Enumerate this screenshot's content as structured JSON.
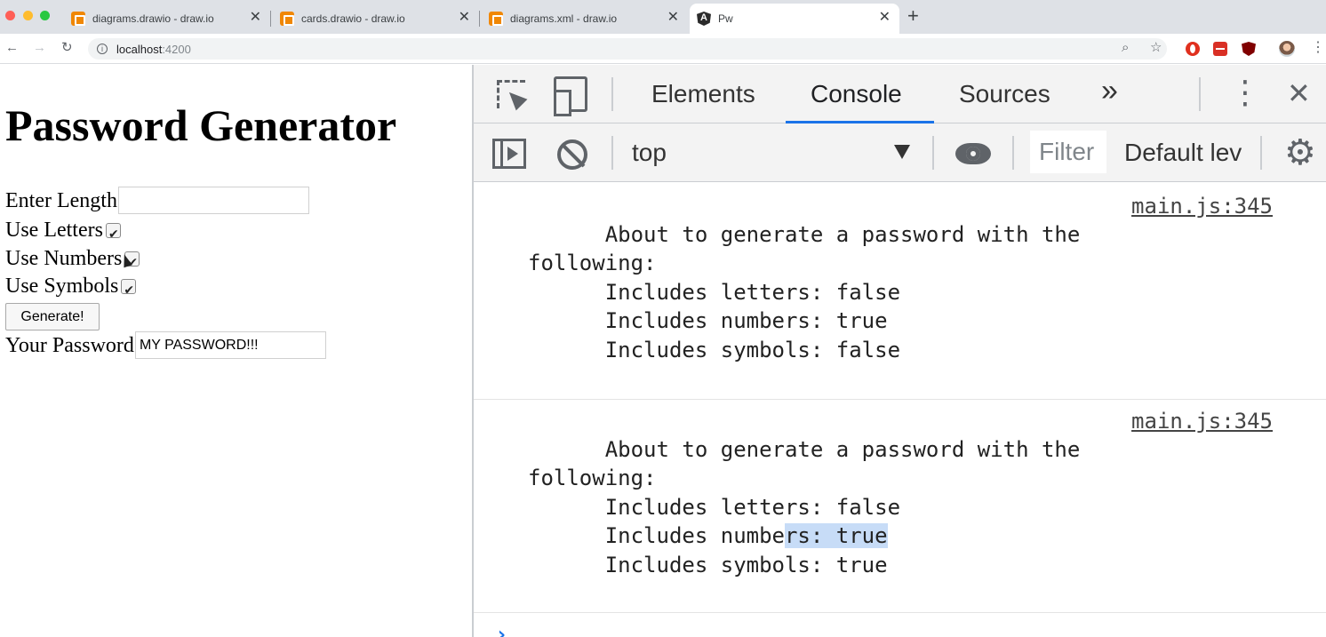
{
  "browser": {
    "tabs": [
      {
        "title": "diagrams.drawio - draw.io",
        "icon": "drawio-icon",
        "active": false
      },
      {
        "title": "cards.drawio - draw.io",
        "icon": "drawio-icon",
        "active": false
      },
      {
        "title": "diagrams.xml - draw.io",
        "icon": "drawio-icon",
        "active": false
      },
      {
        "title": "Pw",
        "icon": "angular-icon",
        "active": true
      }
    ],
    "close_glyph": "✕",
    "new_tab_glyph": "+",
    "url_host": "localhost",
    "url_port": ":4200"
  },
  "app": {
    "heading": "Password Generator",
    "length_label": "Enter Length",
    "length_value": "",
    "letters_label": "Use Letters",
    "letters_checked": true,
    "numbers_label": "Use Numbers",
    "numbers_checked": true,
    "symbols_label": "Use Symbols",
    "symbols_checked": true,
    "generate_label": "Generate!",
    "password_label": "Your Password",
    "password_value": "MY PASSWORD!!!"
  },
  "devtools": {
    "tabs": [
      "Elements",
      "Console",
      "Sources"
    ],
    "active_tab": "Console",
    "more_tabs_glyph": "»",
    "context": "top",
    "filter_placeholder": "Filter",
    "levels": "Default lev",
    "accent": "#1a73e8",
    "messages": [
      {
        "source": "main.js:345",
        "lines": [
          "      About to generate a password with the",
          "following:",
          "      Includes letters: false",
          "      Includes numbers: true",
          "      Includes symbols: false"
        ]
      },
      {
        "source": "main.js:345",
        "lines": [
          "      About to generate a password with the",
          "following:",
          "      Includes letters: false",
          "      Includes numbe",
          "rs: true",
          "      Includes symbols: true"
        ]
      }
    ],
    "prompt_glyph": "›"
  }
}
